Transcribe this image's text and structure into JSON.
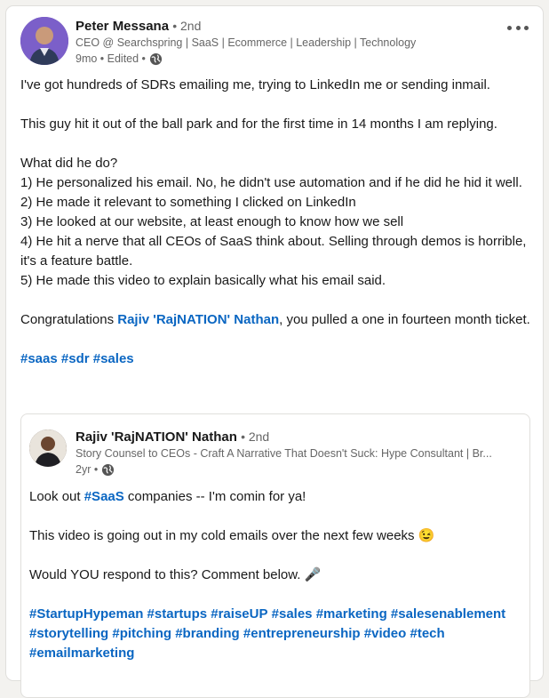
{
  "post": {
    "author_name": "Peter Messana",
    "degree": "• 2nd",
    "headline": "CEO @ Searchspring | SaaS | Ecommerce | Leadership | Technology",
    "time": "9mo • Edited •",
    "visibility_icon": "globe-icon",
    "more_icon": "more-horizontal-icon",
    "paragraphs": [
      "I've got hundreds of SDRs emailing me, trying to LinkedIn me or sending inmail.",
      "This guy hit it out of the ball park and for the first time in 14 months I am replying.",
      "What did he do?",
      "1) He personalized his email. No, he didn't use automation and if he did he hid it well.",
      "2) He made it relevant to something I clicked on LinkedIn",
      "3) He looked at our website, at least enough to know how we sell",
      "4) He hit a nerve that all CEOs of SaaS think about. Selling through demos is horrible, it's a feature battle.",
      "5) He made this video to explain basically what his email said."
    ],
    "congrats_prefix": "Congratulations ",
    "congrats_mention": "Rajiv 'RajNATION' Nathan",
    "congrats_suffix": ", you pulled a one in fourteen month ticket.",
    "hashtags": [
      "#saas",
      "#sdr",
      "#sales"
    ]
  },
  "reshare": {
    "author_name": "Rajiv 'RajNATION' Nathan",
    "degree": "• 2nd",
    "headline": "Story Counsel to CEOs - Craft A Narrative That Doesn't Suck: Hype Consultant | Br...",
    "time": "2yr •",
    "visibility_icon": "globe-icon",
    "line1_prefix": "Look out ",
    "line1_tag": "#SaaS",
    "line1_suffix": " companies -- I'm comin for ya!",
    "line2": "This video is going out in my cold emails over the next few weeks 😉",
    "line3": "Would YOU respond to this? Comment below. 🎤",
    "hashtags": [
      "#StartupHypeman",
      "#startups",
      "#raiseUP",
      "#sales",
      "#marketing",
      "#salesenablement",
      "#storytelling",
      "#pitching",
      "#branding",
      "#entrepreneurship",
      "#video",
      "#tech",
      "#emailmarketing"
    ]
  },
  "colors": {
    "link": "#0a66c2",
    "muted": "#666666",
    "text": "#191919"
  }
}
